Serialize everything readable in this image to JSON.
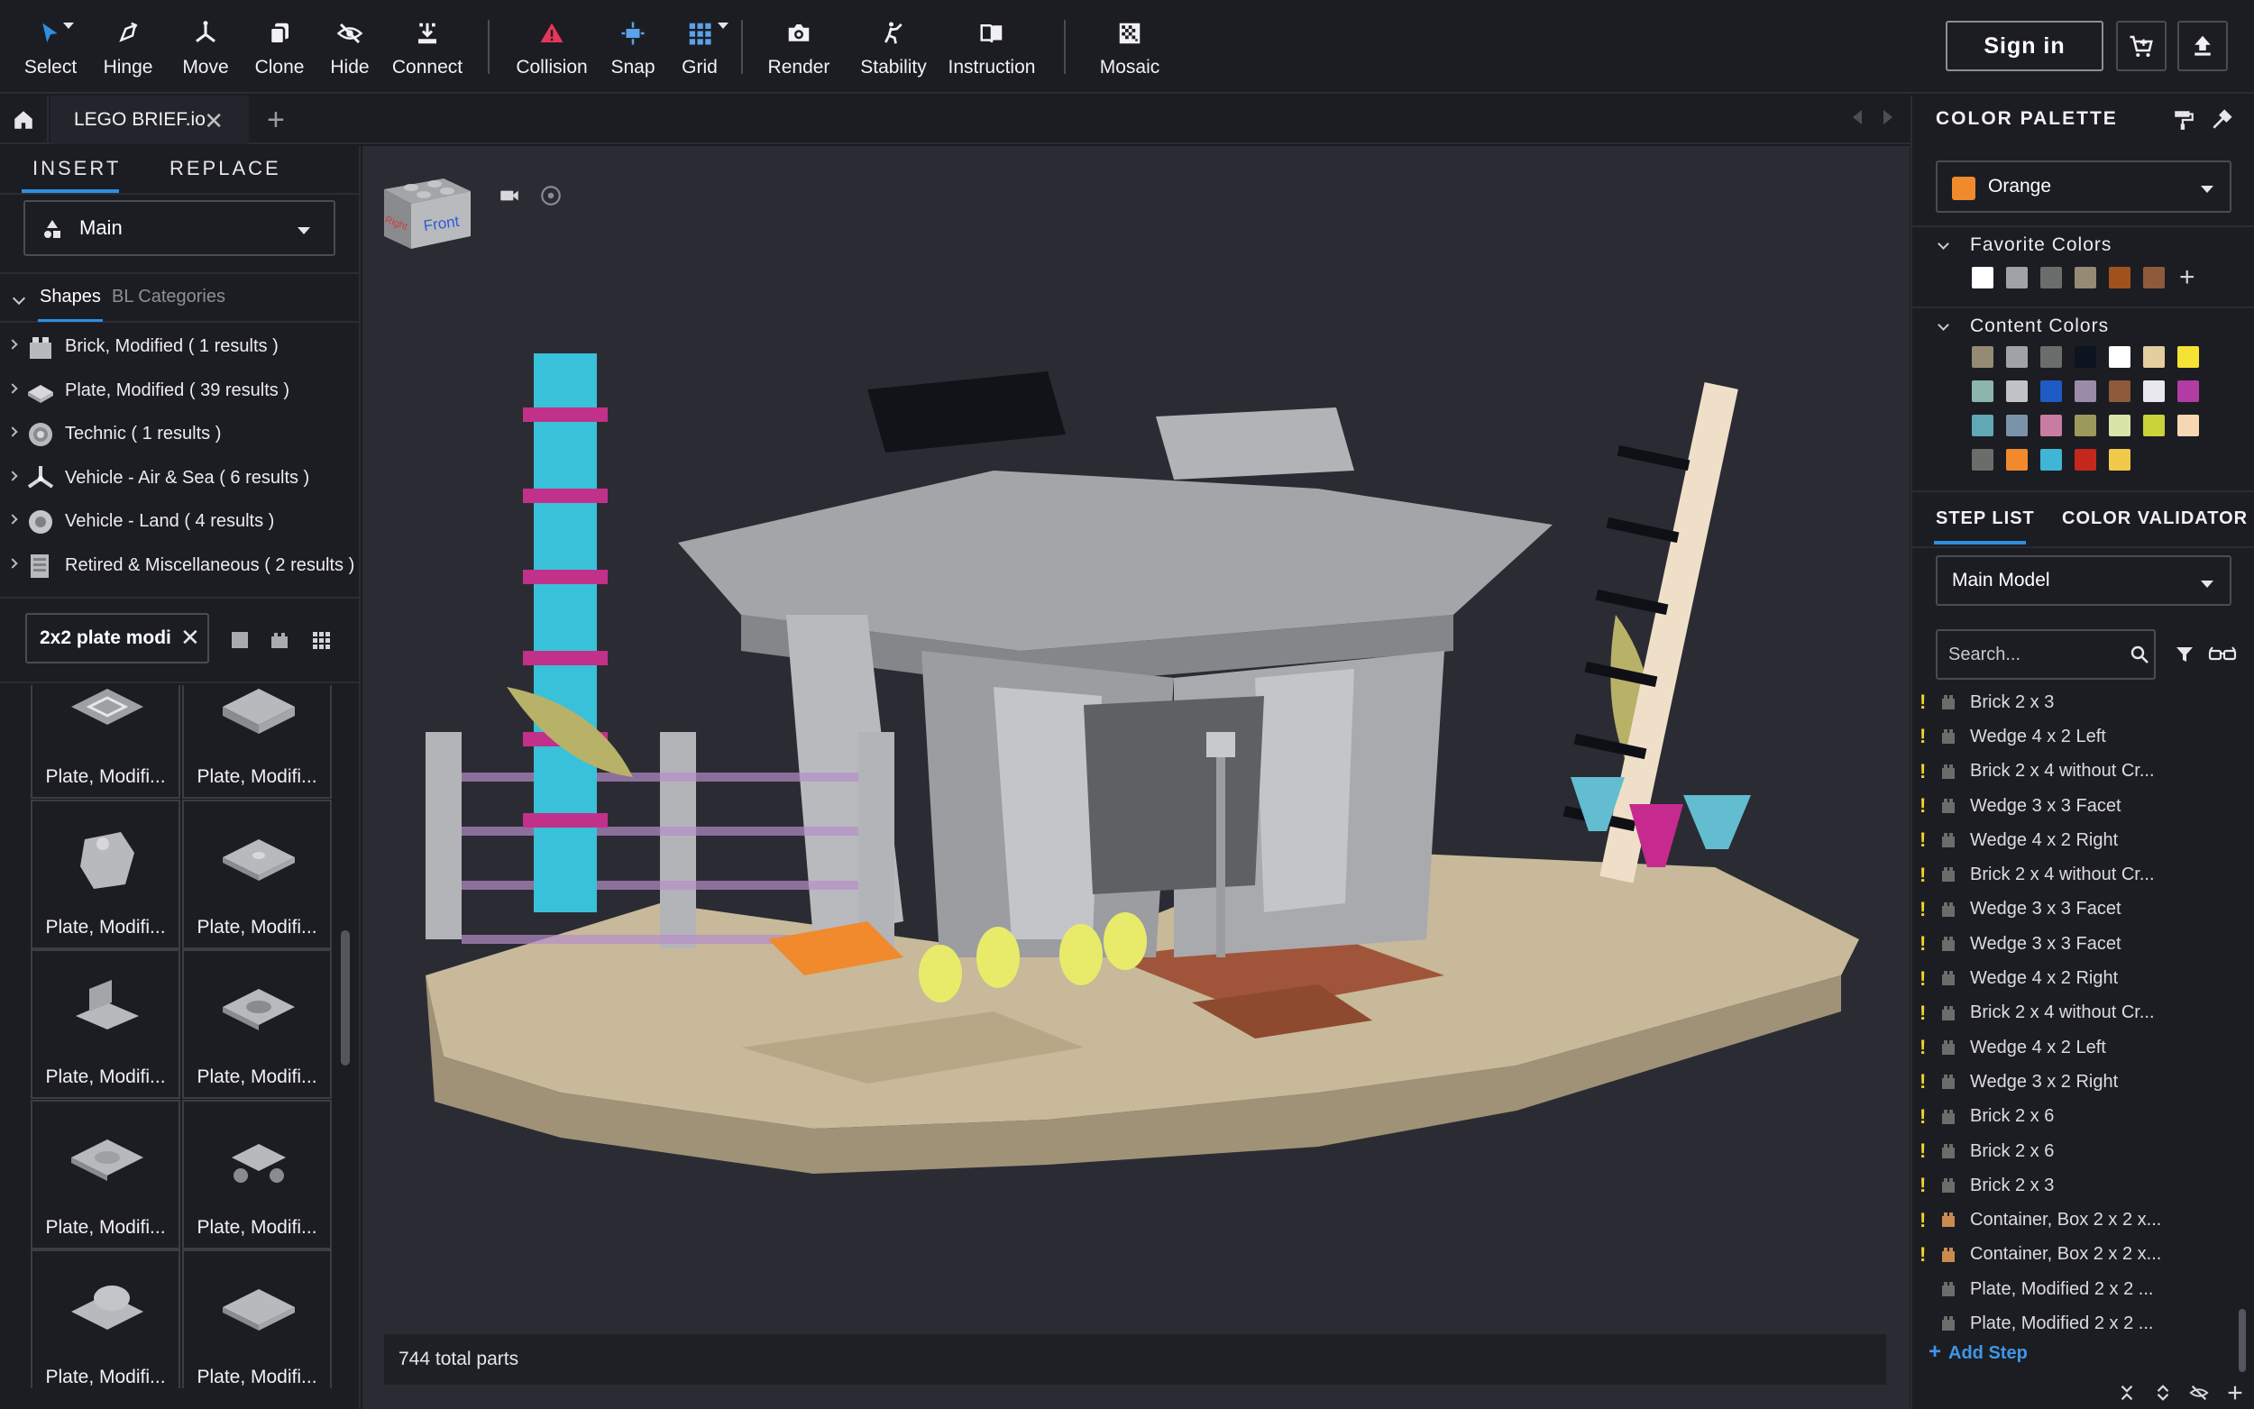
{
  "toolbar": {
    "tools": [
      {
        "label": "Select",
        "icon": "cursor-icon"
      },
      {
        "label": "Hinge",
        "icon": "hinge-icon"
      },
      {
        "label": "Move",
        "icon": "move-icon"
      },
      {
        "label": "Clone",
        "icon": "clone-icon"
      },
      {
        "label": "Hide",
        "icon": "eye-off-icon"
      },
      {
        "label": "Connect",
        "icon": "connect-icon"
      },
      {
        "label": "Collision",
        "icon": "warning-icon"
      },
      {
        "label": "Snap",
        "icon": "snap-icon"
      },
      {
        "label": "Grid",
        "icon": "grid-icon"
      },
      {
        "label": "Render",
        "icon": "camera-icon"
      },
      {
        "label": "Stability",
        "icon": "stability-icon"
      },
      {
        "label": "Instruction",
        "icon": "book-icon"
      },
      {
        "label": "Mosaic",
        "icon": "mosaic-icon"
      }
    ],
    "sign_in": "Sign in",
    "cart_icon": "cart-icon",
    "upload_icon": "upload-icon"
  },
  "tabs": {
    "document": "LEGO BRIEF.io",
    "add": "+"
  },
  "left_panel": {
    "tab_insert": "INSERT",
    "tab_replace": "REPLACE",
    "main_select": "Main",
    "tab_shapes": "Shapes",
    "tab_bl": "BL Categories",
    "categories": [
      {
        "label": "Brick, Modified ( 1 results )",
        "icon": "brick-icon"
      },
      {
        "label": "Plate, Modified ( 39 results )",
        "icon": "plate-icon"
      },
      {
        "label": "Technic ( 1 results )",
        "icon": "technic-icon"
      },
      {
        "label": "Vehicle - Air & Sea ( 6 results )",
        "icon": "propeller-icon"
      },
      {
        "label": "Vehicle - Land ( 4 results )",
        "icon": "wheel-icon"
      },
      {
        "label": "Retired & Miscellaneous ( 2 results )",
        "icon": "misc-icon"
      }
    ],
    "search_value": "2x2 plate modi",
    "parts": [
      "Plate, Modifi...",
      "Plate, Modifi...",
      "Plate, Modifi...",
      "Plate, Modifi...",
      "Plate, Modifi...",
      "Plate, Modifi...",
      "Plate, Modifi...",
      "Plate, Modifi...",
      "Plate, Modifi...",
      "Plate, Modifi..."
    ]
  },
  "viewport": {
    "cube_front": "Front",
    "cube_side": "Right",
    "status": "744 total parts"
  },
  "right_panel": {
    "palette_title": "COLOR PALETTE",
    "selected_color": "Orange",
    "selected_hex": "#f08a2c",
    "favorite_title": "Favorite Colors",
    "favorite_colors": [
      "#ffffff",
      "#a0a2a8",
      "#6b6d6a",
      "#958a73",
      "#a0521d",
      "#8d5a3c"
    ],
    "content_title": "Content Colors",
    "content_colors": [
      "#958a73",
      "#a0a2a8",
      "#6b6d6a",
      "#0c1420",
      "#ffffff",
      "#e4cd9e",
      "#f5e235",
      "#8db5ad",
      "#c0c2c6",
      "#1f5bc4",
      "#9a8ca8",
      "#8d5a3c",
      "#e8e8ee",
      "#b23ba4",
      "#5fa8b4",
      "#7a93a8",
      "#c87ca2",
      "#9b9a5a",
      "#d9e4a8",
      "#c9d43a",
      "#f6d7b3",
      "#6b6d6a",
      "#f08a2c",
      "#3fb6d6",
      "#c4281c",
      "#f2c84b"
    ],
    "tab_steps": "STEP LIST",
    "tab_validator": "COLOR VALIDATOR",
    "model_select": "Main Model",
    "search_placeholder": "Search...",
    "steps": [
      {
        "label": "Brick 2 x 3",
        "warn": "!",
        "color": "#6b6d6a"
      },
      {
        "label": "Wedge 4 x 2 Left",
        "warn": "!",
        "color": "#6b6d6a"
      },
      {
        "label": "Brick 2 x 4 without Cr...",
        "warn": "!",
        "color": "#6b6d6a"
      },
      {
        "label": "Wedge 3 x 3 Facet",
        "warn": "!",
        "color": "#6b6d6a"
      },
      {
        "label": "Wedge 4 x 2 Right",
        "warn": "!",
        "color": "#6b6d6a"
      },
      {
        "label": "Brick 2 x 4 without Cr...",
        "warn": "!",
        "color": "#6b6d6a"
      },
      {
        "label": "Wedge 3 x 3 Facet",
        "warn": "!",
        "color": "#6b6d6a"
      },
      {
        "label": "Wedge 3 x 3 Facet",
        "warn": "!",
        "color": "#6b6d6a"
      },
      {
        "label": "Wedge 4 x 2 Right",
        "warn": "!",
        "color": "#6b6d6a"
      },
      {
        "label": "Brick 2 x 4 without Cr...",
        "warn": "!",
        "color": "#6b6d6a"
      },
      {
        "label": "Wedge 4 x 2 Left",
        "warn": "!",
        "color": "#6b6d6a"
      },
      {
        "label": "Wedge 3 x 2  Right",
        "warn": "!",
        "color": "#6b6d6a"
      },
      {
        "label": "Brick 2 x 6",
        "warn": "!",
        "color": "#6b6d6a"
      },
      {
        "label": "Brick 2 x 6",
        "warn": "!",
        "color": "#6b6d6a"
      },
      {
        "label": "Brick 2 x 3",
        "warn": "!",
        "color": "#6b6d6a"
      },
      {
        "label": "Container, Box 2 x 2 x...",
        "warn": "!",
        "color": "#c98b4e"
      },
      {
        "label": "Container, Box 2 x 2 x...",
        "warn": "!",
        "color": "#c98b4e"
      },
      {
        "label": "Plate, Modified 2 x 2 ...",
        "warn": "",
        "color": "#6b6d6a"
      },
      {
        "label": "Plate, Modified 2 x 2 ...",
        "warn": "",
        "color": "#6b6d6a"
      }
    ],
    "add_step": "Add Step"
  }
}
